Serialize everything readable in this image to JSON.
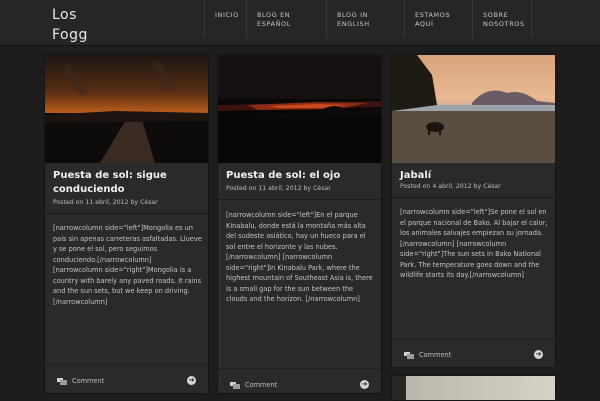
{
  "header": {
    "logo_line1": "Los",
    "logo_line2": "Fogg",
    "nav": [
      {
        "line1": "INICIO",
        "line2": ""
      },
      {
        "line1": "BLOG EN",
        "line2": "ESPAÑOL"
      },
      {
        "line1": "BLOG IN",
        "line2": "ENGLISH"
      },
      {
        "line1": "ESTAMOS",
        "line2": "AQUÍ"
      },
      {
        "line1": "SOBRE",
        "line2": "NOSOTROS"
      }
    ]
  },
  "posts": [
    {
      "title": "Puesta de sol: sigue conduciendo",
      "meta": "Posted on 11 abril, 2012 by César",
      "excerpt": "[narrowcolumn side=\"left\"]Mongolia es un país sin apenas carreteras asfaltadas. Llueve y se pone el sol, pero seguimos conduciendo.[/narrowcolumn] [narrowcolumn side=\"right\"]Mongolia is a country with barely any paved roads. It rains and the sun sets, but we keep on driving.[/narrowcolumn]",
      "comment_label": "Comment",
      "more_icon": "arrow-right-circle-icon"
    },
    {
      "title": "Puesta de sol: el ojo",
      "meta": "Posted on 11 abril, 2012 by César",
      "excerpt": "[narrowcolumn side=\"left\"]En el parque Kinabalu, donde está la montaña más alta del sudeste asiático, hay un hueco para el sol entre el horizonte y las nubes. [/narrowcolumn] [narrowcolumn side=\"right\"]In Kinabalu Park, where the highest mountain of Southeast Asia is, there is a small gap for the sun between the clouds and the horizon. [/narrowcolumn]",
      "comment_label": "Comment",
      "more_icon": "arrow-right-circle-icon"
    },
    {
      "title": "Jabalí",
      "meta": "Posted on 4 abril, 2012 by César",
      "excerpt": "[narrowcolumn side=\"left\"]Se pone el sol en el parque nacional de Bako. Al bajar el calor, los animales salvajes empiezan su jornada.[/narrowcolumn] [narrowcolumn side=\"right\"]The sun sets in Bako National Park. The temperature goes down and the wildlife starts its day.[/narrowcolumn]",
      "comment_label": "Comment",
      "more_icon": "arrow-right-circle-icon"
    }
  ],
  "colors": {
    "background": "#1d1d1d",
    "card": "#2a2a2a",
    "header": "#262626",
    "text": "#cfcfcf",
    "title": "#f0f0f0"
  }
}
